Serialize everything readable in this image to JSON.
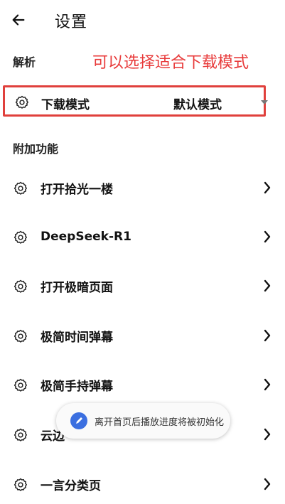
{
  "header": {
    "title": "设置"
  },
  "parse_section": {
    "title_visible": "解析",
    "annotation": "可以选择适合下载模式",
    "download_mode": {
      "label": "下载模式",
      "value": "默认模式"
    }
  },
  "extra_section": {
    "title": "附加功能"
  },
  "items": [
    {
      "label": "打开拾光一楼"
    },
    {
      "label": "DeepSeek-R1"
    },
    {
      "label": "打开极暗页面"
    },
    {
      "label": "极简时间弹幕"
    },
    {
      "label": "极简手持弹幕"
    },
    {
      "label": "云边"
    },
    {
      "label": "一言分类页"
    }
  ],
  "toast": {
    "text": "离开首页后播放进度将被初始化"
  }
}
